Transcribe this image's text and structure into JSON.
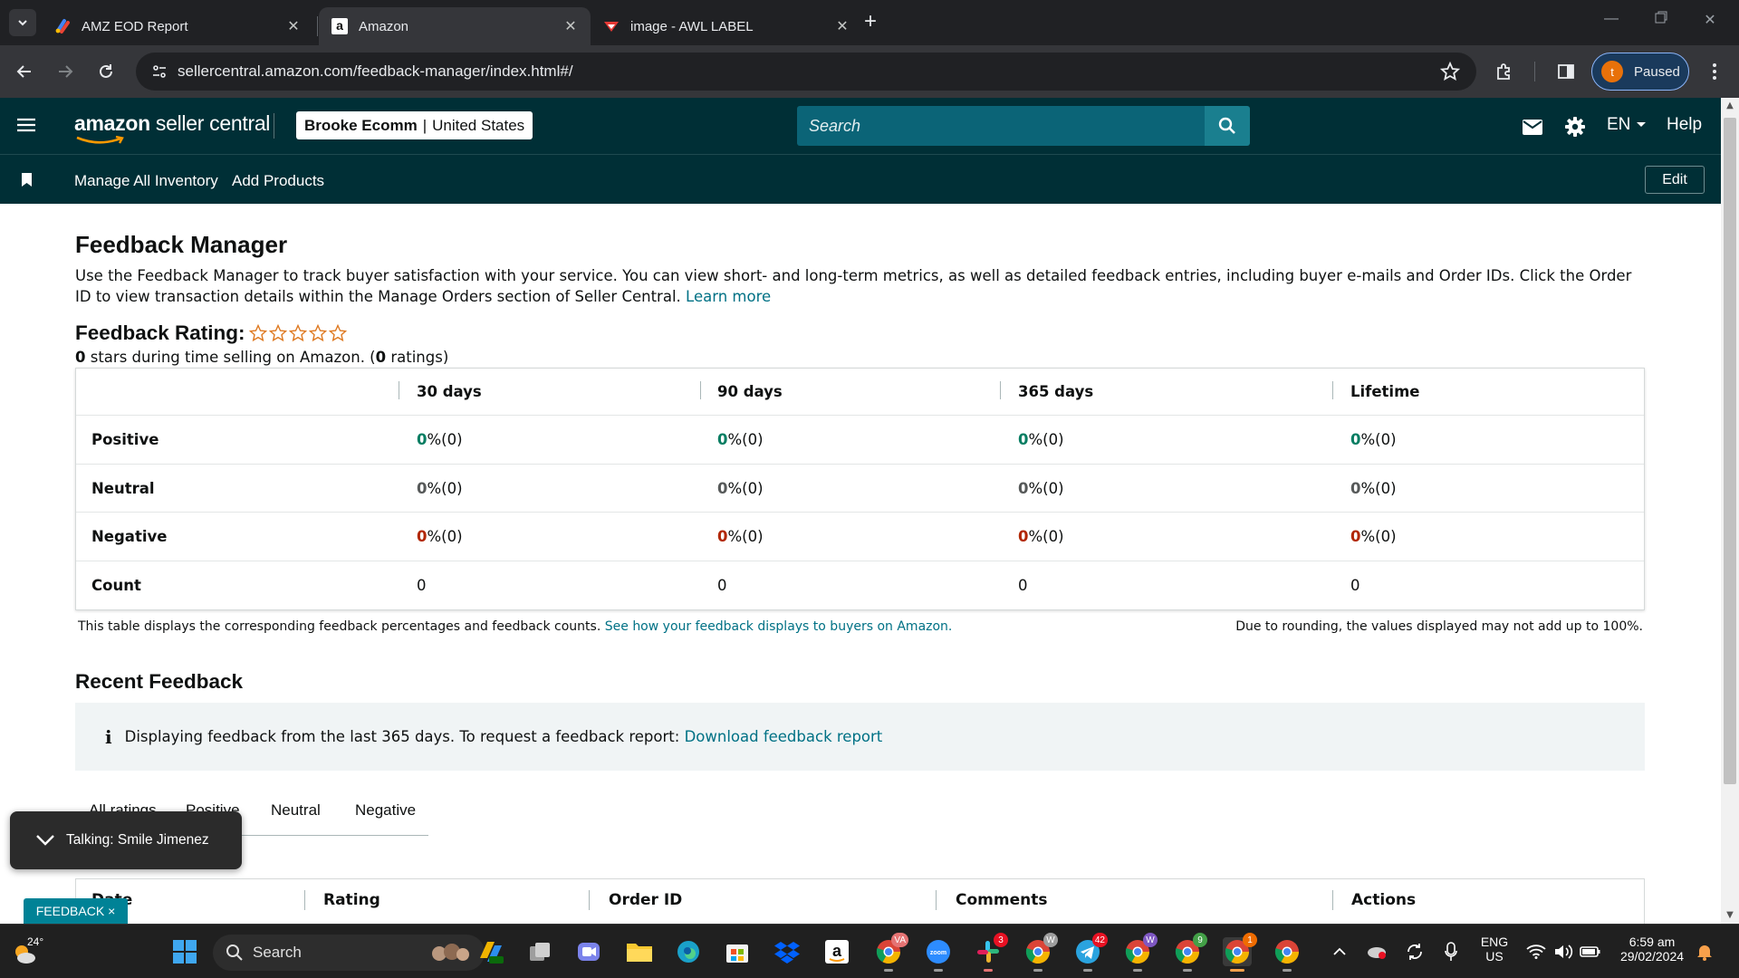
{
  "browser": {
    "tabs": [
      {
        "title": "AMZ EOD Report",
        "active": false
      },
      {
        "title": "Amazon",
        "active": true
      },
      {
        "title": "image - AWL LABEL",
        "active": false
      }
    ],
    "url": "sellercentral.amazon.com/feedback-manager/index.html#/",
    "profile_initial": "t",
    "profile_status": "Paused"
  },
  "header": {
    "logo_text_1": "amazon",
    "logo_text_2": " seller central",
    "account_name": "Brooke Ecomm",
    "account_separator": "|",
    "marketplace": "United States",
    "search_placeholder": "Search",
    "language": "EN",
    "help": "Help"
  },
  "subnav": {
    "links": [
      "Manage All Inventory",
      "Add Products"
    ],
    "edit": "Edit"
  },
  "page": {
    "title": "Feedback Manager",
    "description": "Use the Feedback Manager to track buyer satisfaction with your service. You can view short- and long-term metrics, as well as detailed feedback entries, including buyer e-mails and Order IDs. Click the Order ID to view transaction details within the Manage Orders section of Seller Central.",
    "learn_more": "Learn more",
    "rating_title": "Feedback Rating:",
    "star_count": 0,
    "rating_stars_value": "0",
    "rating_sub_mid": " stars during time selling on Amazon. (",
    "rating_count": "0",
    "rating_sub_end": " ratings)"
  },
  "table": {
    "columns": [
      "30 days",
      "90 days",
      "365 days",
      "Lifetime"
    ],
    "rows": [
      {
        "label": "Positive",
        "values": [
          [
            "0",
            " %(0)"
          ],
          [
            "0",
            " %(0)"
          ],
          [
            "0",
            " %(0)"
          ],
          [
            "0",
            " %(0)"
          ]
        ]
      },
      {
        "label": "Neutral",
        "values": [
          [
            "0",
            " %(0)"
          ],
          [
            "0",
            " %(0)"
          ],
          [
            "0",
            " %(0)"
          ],
          [
            "0",
            " %(0)"
          ]
        ]
      },
      {
        "label": "Negative",
        "values": [
          [
            "0",
            " %(0)"
          ],
          [
            "0",
            " %(0)"
          ],
          [
            "0",
            " %(0)"
          ],
          [
            "0",
            " %(0)"
          ]
        ]
      },
      {
        "label": "Count",
        "values": [
          "0",
          "0",
          "0",
          "0"
        ]
      }
    ],
    "note": "This table displays the corresponding feedback percentages and feedback counts.",
    "note_link": "See how your feedback displays to buyers on Amazon.",
    "rounding_note": "Due to rounding, the values displayed may not add up to 100%."
  },
  "recent": {
    "title": "Recent Feedback",
    "info_text": "Displaying feedback from the last 365 days. To request a feedback report: ",
    "info_link": "Download feedback report",
    "tabs": [
      "All ratings",
      "Positive",
      "Neutral",
      "Negative"
    ],
    "list_columns": [
      "Date",
      "Rating",
      "Order ID",
      "Comments",
      "Actions"
    ]
  },
  "overlays": {
    "talking": "Talking: Smile Jimenez",
    "feedback_tab": "FEEDBACK",
    "feedback_close": "×"
  },
  "taskbar": {
    "temperature": "24°",
    "search_label": "Search",
    "badges": {
      "chrome_va": "VA",
      "slack": "3",
      "telegram": "42",
      "chrome_w": "W",
      "chrome_9": "9",
      "chrome_1": "1"
    },
    "lang_1": "ENG",
    "lang_2": "US",
    "time": "6:59 am",
    "date": "29/02/2024"
  },
  "colors": {
    "header_bg": "#002f36",
    "link": "#007185",
    "positive": "#067d62",
    "negative": "#b12704",
    "info_bg": "#f0f4f5"
  }
}
